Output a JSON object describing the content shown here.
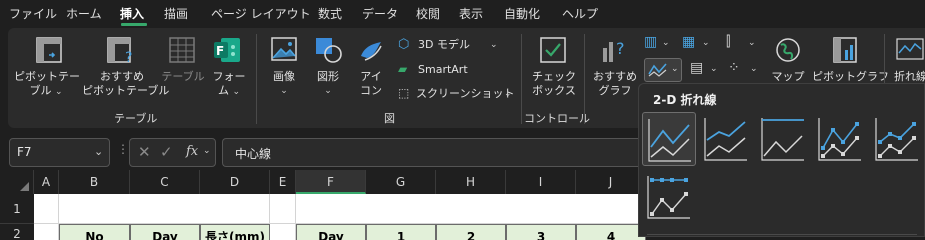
{
  "menu": {
    "tabs": [
      "ファイル",
      "ホーム",
      "挿入",
      "描画",
      "ページ レイアウト",
      "数式",
      "データ",
      "校閲",
      "表示",
      "自動化",
      "ヘルプ"
    ],
    "active": "挿入"
  },
  "ribbon": {
    "pivot_table": [
      "ピボットテー",
      "ブル"
    ],
    "recommended_pivot": [
      "おすすめ",
      "ピボットテーブル"
    ],
    "table": "テーブル",
    "forms": [
      "フォー",
      "ム"
    ],
    "group_table": "テーブル",
    "images": "画像",
    "shapes": "図形",
    "icons": [
      "アイ",
      "コン"
    ],
    "model3d": "3D モデル",
    "smartart": "SmartArt",
    "screenshot": "スクリーンショット",
    "group_illust": "図",
    "checkbox": [
      "チェック",
      "ボックス"
    ],
    "group_control": "コントロール",
    "recommended_chart": [
      "おすすめ",
      "グラフ"
    ],
    "maps": "マップ",
    "pivot_chart": "ピボットグラフ",
    "sparkline": "折れ線"
  },
  "formula_bar": {
    "name_box": "F7",
    "fx": "fx",
    "content": "中心線"
  },
  "grid": {
    "columns": [
      "A",
      "B",
      "C",
      "D",
      "E",
      "F",
      "G",
      "H",
      "I",
      "J"
    ],
    "rows": [
      "1",
      "2"
    ],
    "row2": [
      "No",
      "Day",
      "長さ(mm)",
      "Day",
      "1",
      "2",
      "3",
      "4"
    ]
  },
  "dropdown": {
    "title": "2-D 折れ線",
    "options": [
      "line",
      "stacked-line",
      "100-stacked-line",
      "line-markers",
      "stacked-line-markers",
      "100-stacked-line-markers"
    ],
    "selected": "line"
  }
}
